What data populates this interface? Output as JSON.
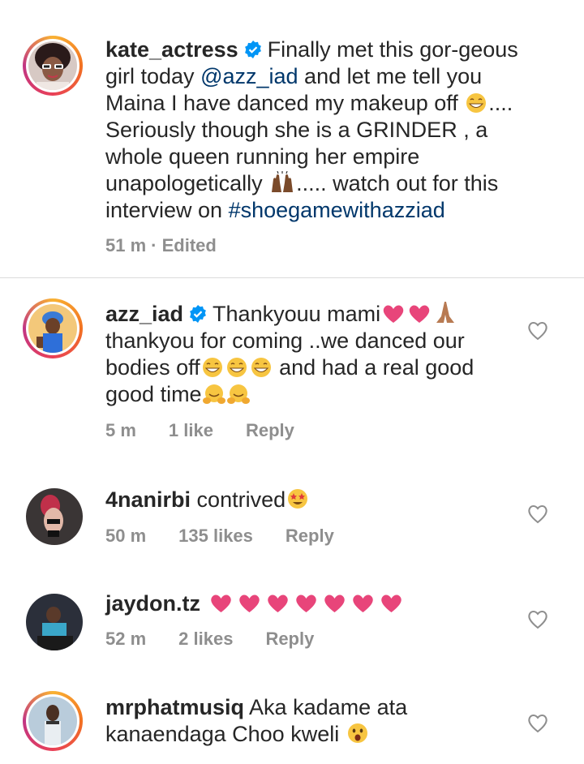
{
  "comments": [
    {
      "username": "kate_actress",
      "parts": {
        "t1": "Finally  met this gor-geous girl today ",
        "mention": "@azz_iad",
        "t2": " and let me tell you Maina I have danced my makeup off ",
        "t3": ".... Seriously though she is a GRINDER , a whole queen running her empire unapologetically ",
        "t4": "..... watch out for this interview on ",
        "hashtag": "#shoegamewithazziad"
      },
      "time": "51 m",
      "edited": "· Edited"
    },
    {
      "username": "azz_iad",
      "parts": {
        "t1": "Thankyouu mami",
        "t2": "thankyou for coming ..we danced our bodies off",
        "t3": " and had a real good good time"
      },
      "time": "5 m",
      "likes": "1 like",
      "reply": "Reply"
    },
    {
      "username": "4nanirbi",
      "text": "contrived",
      "time": "50 m",
      "likes": "135 likes",
      "reply": "Reply"
    },
    {
      "username": "jaydon.tz",
      "time": "52 m",
      "likes": "2 likes",
      "reply": "Reply"
    },
    {
      "username": "mrphatmusiq",
      "text": "Aka kadame ata kanaendaga Choo kweli",
      "time": "",
      "likes": "",
      "reply": ""
    }
  ],
  "colors": {
    "verified": "#0095f6",
    "heart": "#e8457a",
    "link": "#00376b",
    "meta": "#8e8e8e"
  },
  "icons": [
    "verified-badge-icon",
    "heart-outline-icon",
    "heart-emoji",
    "grinning-emoji",
    "raised-hands-emoji",
    "folded-hands-emoji",
    "hugging-emoji",
    "star-struck-emoji",
    "surprised-emoji"
  ]
}
